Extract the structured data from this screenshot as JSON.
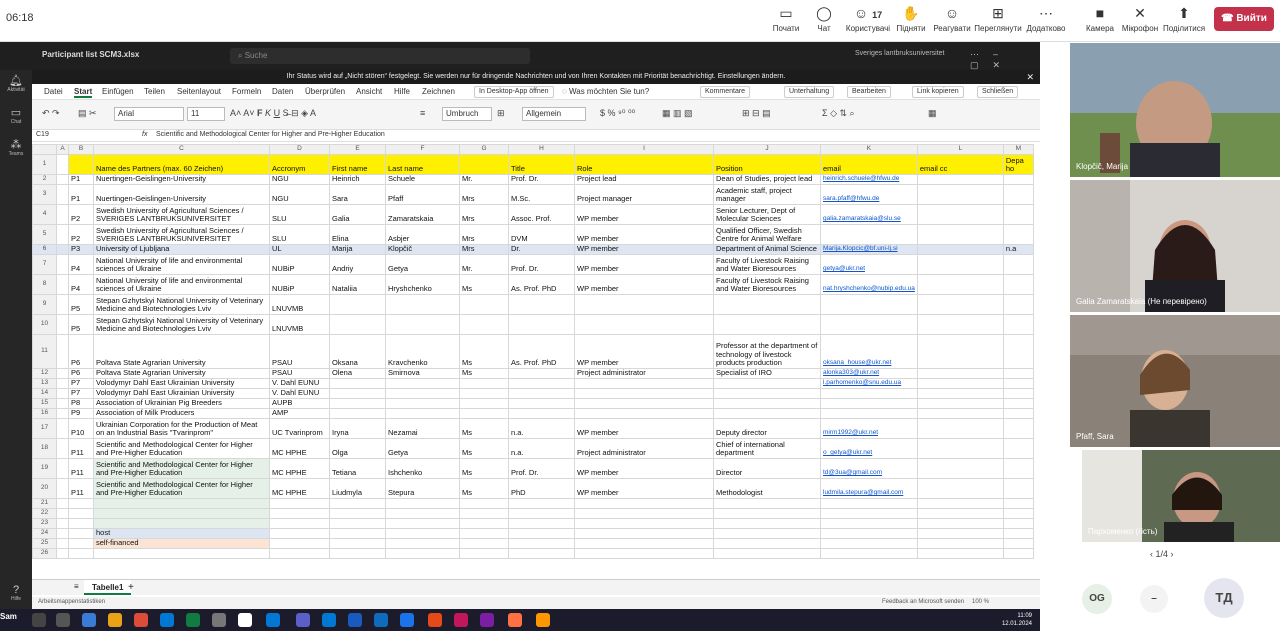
{
  "clock": "06:18",
  "toolbar": {
    "share": "Почати",
    "chat": "Чат",
    "people_count": "17",
    "people": "Користувачі",
    "raise": "Підняти",
    "react": "Реагувати",
    "view": "Переглянути",
    "more": "Додатково",
    "camera": "Камера",
    "mic": "Мікрофон",
    "share2": "Поділитися",
    "leave": "Вийти"
  },
  "app": {
    "file_title": "Participant list SCM3.xlsx",
    "search": "Suche",
    "org": "Sveriges lantbruksuniversitet",
    "rail": [
      "Aktivität",
      "Chat",
      "Teams",
      "Hilfe"
    ],
    "notification": "Ihr Status wird auf „Nicht stören“ festgelegt. Sie werden nur für dringende Nachrichten und von Ihren Kontakten mit Priorität benachrichtigt. Einstellungen ändern.",
    "menu": [
      "Datei",
      "Start",
      "Einfügen",
      "Teilen",
      "Seitenlayout",
      "Formeln",
      "Daten",
      "Überprüfen",
      "Ansicht",
      "Hilfe",
      "Zeichnen"
    ],
    "menu_right": [
      "In Desktop-App öffnen",
      "Was möchten Sie tun?",
      "Kommentare",
      "Unterhaltung",
      "Bearbeiten",
      "Link kopieren",
      "Schließen"
    ],
    "font": "Arial",
    "font_size": "11",
    "wrap": "Umbruch",
    "format": "Allgemein",
    "cell_ref": "C19",
    "formula": "Scientific and Methodological Center for Higher and Pre-Higher Education",
    "sheet_tab": "Tabelle1",
    "status_left": "Arbeitsmappenstatistiken",
    "status_right": "Feedback an Microsoft senden",
    "zoom": "100 %",
    "task_label": "Sam",
    "task_time": "11:09",
    "task_date": "12.01.2024"
  },
  "sheet": {
    "columns": [
      "A",
      "B",
      "C",
      "D",
      "E",
      "F",
      "G",
      "H",
      "I",
      "J",
      "K",
      "L",
      "M"
    ],
    "header": [
      "",
      "Name des Partners (max. 60 Zeichen)",
      "Accronym",
      "First name",
      "Last name",
      "",
      "Title",
      "Role",
      "Position",
      "email",
      "email cc",
      "Depa ho"
    ],
    "rows": [
      [
        "P1",
        "Nuertingen-Geislingen-University",
        "NGU",
        "Heinrich",
        "Schuele",
        "Mr.",
        "Prof. Dr.",
        "Project lead",
        "Dean of Studies, project lead",
        "heinrich.schuele@hfwu.de",
        "",
        ""
      ],
      [
        "P1",
        "Nuertingen-Geislingen-University",
        "NGU",
        "Sara",
        "Pfaff",
        "Mrs",
        "M.Sc.",
        "Project manager",
        "Academic staff, project manager",
        "sara.pfaff@hfwu.de",
        "",
        ""
      ],
      [
        "P2",
        "Swedish University of Agricultural Sciences / SVERIGES LANTBRUKSUNIVERSITET",
        "SLU",
        "Galia",
        "Zamaratskaia",
        "Mrs",
        "Assoc. Prof.",
        "WP member",
        "Senior Lecturer, Dept of Molecular Sciences",
        "galia.zamaratskaia@slu.se",
        "",
        ""
      ],
      [
        "P2",
        "Swedish University of Agricultural Sciences / SVERIGES LANTBRUKSUNIVERSITET",
        "SLU",
        "Elina",
        "Asbjer",
        "Mrs",
        "DVM",
        "WP member",
        "Qualified Officer, Swedish Centre for Animal Welfare",
        "",
        "",
        ""
      ],
      [
        "P3",
        "University of Ljubljana",
        "UL",
        "Marija",
        "Klopčič",
        "Mrs",
        "Dr.",
        "WP member",
        "Department of Animal Science",
        "Marija.Klopcic@bf.uni-lj.si",
        "",
        "n.a"
      ],
      [
        "P4",
        "National University of life and environmental sciences of Ukraine",
        "NUBiP",
        "Andriy",
        "Getya",
        "Mr.",
        "Prof. Dr.",
        "WP member",
        "Faculty of Livestock Raising and Water Bioresources",
        "getya@ukr.net",
        "",
        ""
      ],
      [
        "P4",
        "National University of life and environmental sciences of Ukraine",
        "NUBiP",
        "Nataliia",
        "Hryshchenko",
        "Ms",
        "As. Prof. PhD",
        "WP member",
        "Faculty of Livestock Raising and Water Bioresources",
        "nat.hryshchenko@nubip.edu.ua",
        "",
        ""
      ],
      [
        "P5",
        "Stepan Gzhytskyi National University of Veterinary Medicine and Biotechnologies Lviv",
        "LNUVMB",
        "",
        "",
        "",
        "",
        "",
        "",
        "",
        "",
        ""
      ],
      [
        "P5",
        "Stepan Gzhytskyi National University of Veterinary Medicine and Biotechnologies Lviv",
        "LNUVMB",
        "",
        "",
        "",
        "",
        "",
        "",
        "",
        "",
        ""
      ],
      [
        "P6",
        "Poltava State Agrarian University",
        "PSAU",
        "Oksana",
        "Kravchenko",
        "Ms",
        "As. Prof. PhD",
        "WP member",
        "Professor at the department of technology of livestock products production",
        "oksana_house@ukr.net",
        "",
        ""
      ],
      [
        "P6",
        "Poltava State Agrarian University",
        "PSAU",
        "Olena",
        "Smirnova",
        "Ms",
        "",
        "Project administrator",
        "Specialist of IRO",
        "alonka303@ukr.net",
        "",
        ""
      ],
      [
        "P7",
        "Volodymyr Dahl East Ukrainian University",
        "V. Dahl EUNU",
        "",
        "",
        "",
        "",
        "",
        "",
        "l.parhomenko@snu.edu.ua",
        "",
        ""
      ],
      [
        "P7",
        "Volodymyr Dahl East Ukrainian University",
        "V. Dahl EUNU",
        "",
        "",
        "",
        "",
        "",
        "",
        "",
        "",
        ""
      ],
      [
        "P8",
        "Association of Ukrainian Pig Breeders",
        "AUPB",
        "",
        "",
        "",
        "",
        "",
        "",
        "",
        "",
        ""
      ],
      [
        "P9",
        "Association of Milk Producers",
        "AMP",
        "",
        "",
        "",
        "",
        "",
        "",
        "",
        "",
        ""
      ],
      [
        "P10",
        "Ukrainian Corporation for the Production of Meat on an Industrial Basis \"Tvarinprom\"",
        "UC Tvarinprom",
        "Iryna",
        "Nezamai",
        "Ms",
        "n.a.",
        "WP member",
        "Deputy director",
        "mirm1992@ukr.net",
        "",
        ""
      ],
      [
        "P11",
        "Scientific and Methodological Center for Higher and Pre-Higher Education",
        "MC HPHE",
        "Olga",
        "Getya",
        "Ms",
        "n.a.",
        "Project administrator",
        "Chief of international department",
        "o_getya@ukr.net",
        "",
        ""
      ],
      [
        "P11",
        "Scientific and Methodological Center for Higher and Pre-Higher Education",
        "MC HPHE",
        "Tetiana",
        "Ishchenko",
        "Ms",
        "Prof. Dr.",
        "WP member",
        "Director",
        "td@3ua@gmail.com",
        "",
        ""
      ],
      [
        "P11",
        "Scientific and Methodological Center for Higher and Pre-Higher Education",
        "MC HPHE",
        "Liudmyla",
        "Stepura",
        "Ms",
        "PhD",
        "WP member",
        "Methodologist",
        "ludmila.stepura@gmail.com",
        "",
        ""
      ]
    ],
    "legend": [
      "host",
      "self-financed"
    ]
  },
  "participants": [
    {
      "name": "Klopčič, Marija"
    },
    {
      "name": "Galia Zamaratskaia (Не перевірено)"
    },
    {
      "name": "Pfaff, Sara"
    },
    {
      "name": "Пархоменко (гість)"
    }
  ],
  "pager": "1/4",
  "avatars": [
    "OG",
    "TД"
  ]
}
